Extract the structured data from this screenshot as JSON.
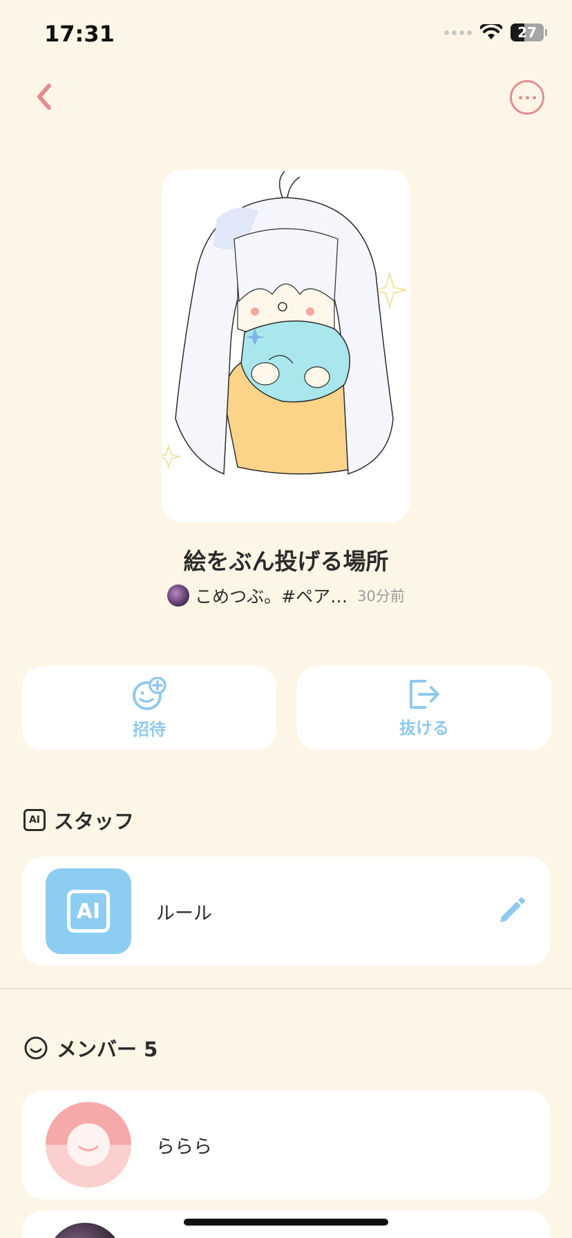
{
  "status_bar": {
    "time": "17:31",
    "battery": "27"
  },
  "room": {
    "title": "絵をぶん投げる場所",
    "owner_name": "こめつぶ。#ペア…",
    "updated": "30分前"
  },
  "actions": {
    "invite": "招待",
    "leave": "抜ける"
  },
  "staff": {
    "heading": "スタッフ",
    "icon_text": "AI",
    "items": [
      {
        "label": "ルール"
      }
    ]
  },
  "members": {
    "heading": "メンバー 5",
    "items": [
      {
        "name": "ららら"
      }
    ]
  },
  "colors": {
    "background": "#fdf6e6",
    "accent_pink": "#e58b93",
    "accent_blue": "#8ec9ee"
  }
}
